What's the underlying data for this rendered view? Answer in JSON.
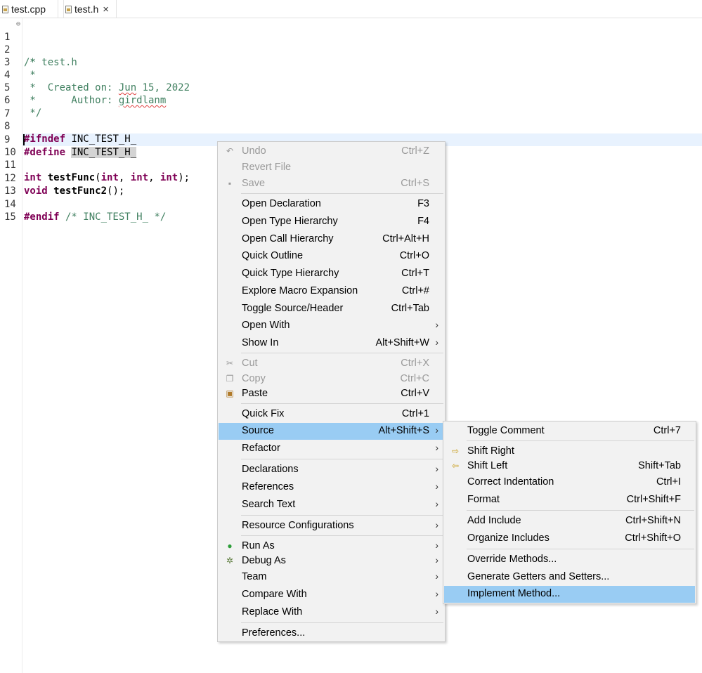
{
  "tabs": [
    {
      "label": "test.cpp",
      "icon": "cpp-file-icon"
    },
    {
      "label": "test.h",
      "icon": "header-file-icon",
      "close": "×"
    }
  ],
  "editor": {
    "line_numbers": [
      "1",
      "2",
      "3",
      "4",
      "5",
      "6",
      "7",
      "8",
      "9",
      "10",
      "11",
      "12",
      "13",
      "14",
      "15"
    ],
    "lines": {
      "l1": "/*",
      "l2": " * test.h",
      "l3": " *",
      "l4a": " *  Created on: ",
      "l4b": "Jun",
      "l4c": " 15, 2022",
      "l5a": " *      Author: ",
      "l5b": "girdlanm",
      "l6": " */",
      "l8a": "#ifndef",
      "l8b": " INC_TEST_H_",
      "l9a": "#define",
      "l9b": "INC_TEST_H_",
      "l11a": "int",
      "l11b": "testFunc",
      "l11c": "(",
      "l11d": "int",
      "l11e": ", ",
      "l11f": "int",
      "l11g": ", ",
      "l11h": "int",
      "l11i": ");",
      "l12a": "void",
      "l12b": "testFunc2",
      "l12c": "();",
      "l14a": "#endif",
      "l14b": " /* INC_TEST_H_ */"
    }
  },
  "context_menu": {
    "items": [
      {
        "label": "Undo",
        "shortcut": "Ctrl+Z"
      },
      {
        "label": "Revert File",
        "shortcut": ""
      },
      {
        "label": "Save",
        "shortcut": "Ctrl+S"
      },
      {
        "label": "Open Declaration",
        "shortcut": "F3"
      },
      {
        "label": "Open Type Hierarchy",
        "shortcut": "F4"
      },
      {
        "label": "Open Call Hierarchy",
        "shortcut": "Ctrl+Alt+H"
      },
      {
        "label": "Quick Outline",
        "shortcut": "Ctrl+O"
      },
      {
        "label": "Quick Type Hierarchy",
        "shortcut": "Ctrl+T"
      },
      {
        "label": "Explore Macro Expansion",
        "shortcut": "Ctrl+#"
      },
      {
        "label": "Toggle Source/Header",
        "shortcut": "Ctrl+Tab"
      },
      {
        "label": "Open With",
        "shortcut": ""
      },
      {
        "label": "Show In",
        "shortcut": "Alt+Shift+W"
      },
      {
        "label": "Cut",
        "shortcut": "Ctrl+X"
      },
      {
        "label": "Copy",
        "shortcut": "Ctrl+C"
      },
      {
        "label": "Paste",
        "shortcut": "Ctrl+V"
      },
      {
        "label": "Quick Fix",
        "shortcut": "Ctrl+1"
      },
      {
        "label": "Source",
        "shortcut": "Alt+Shift+S"
      },
      {
        "label": "Refactor",
        "shortcut": ""
      },
      {
        "label": "Declarations",
        "shortcut": ""
      },
      {
        "label": "References",
        "shortcut": ""
      },
      {
        "label": "Search Text",
        "shortcut": ""
      },
      {
        "label": "Resource Configurations",
        "shortcut": ""
      },
      {
        "label": "Run As",
        "shortcut": ""
      },
      {
        "label": "Debug As",
        "shortcut": ""
      },
      {
        "label": "Team",
        "shortcut": ""
      },
      {
        "label": "Compare With",
        "shortcut": ""
      },
      {
        "label": "Replace With",
        "shortcut": ""
      },
      {
        "label": "Preferences...",
        "shortcut": ""
      }
    ],
    "arrow": "›"
  },
  "source_submenu": {
    "items": [
      {
        "label": "Toggle Comment",
        "shortcut": "Ctrl+7"
      },
      {
        "label": "Shift Right",
        "shortcut": ""
      },
      {
        "label": "Shift Left",
        "shortcut": "Shift+Tab"
      },
      {
        "label": "Correct Indentation",
        "shortcut": "Ctrl+I"
      },
      {
        "label": "Format",
        "shortcut": "Ctrl+Shift+F"
      },
      {
        "label": "Add Include",
        "shortcut": "Ctrl+Shift+N"
      },
      {
        "label": "Organize Includes",
        "shortcut": "Ctrl+Shift+O"
      },
      {
        "label": "Override Methods...",
        "shortcut": ""
      },
      {
        "label": "Generate Getters and Setters...",
        "shortcut": ""
      },
      {
        "label": "Implement Method...",
        "shortcut": ""
      }
    ]
  },
  "colors": {
    "selection": "#99ccf3",
    "menu_bg": "#f2f2f2",
    "keyword": "#7f0055",
    "comment": "#3f7f5f",
    "current_line": "#e8f2fe"
  }
}
